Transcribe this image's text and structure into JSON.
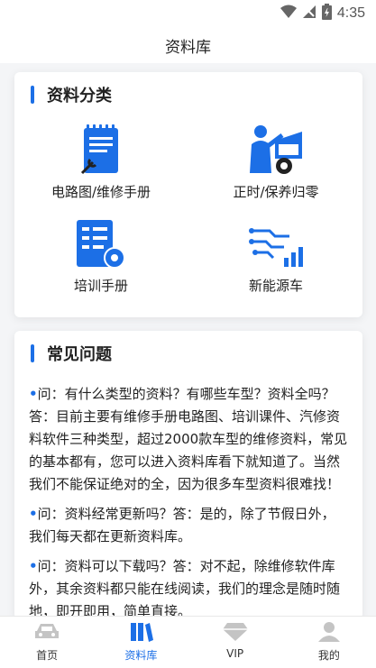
{
  "status": {
    "time": "4:35"
  },
  "header": {
    "title": "资料库"
  },
  "categories": {
    "title": "资料分类",
    "items": [
      {
        "label": "电路图/维修手册",
        "icon": "manual-wrench-icon"
      },
      {
        "label": "正时/保养归零",
        "icon": "mechanic-car-icon"
      },
      {
        "label": "培训手册",
        "icon": "document-gear-icon"
      },
      {
        "label": "新能源车",
        "icon": "circuit-chart-icon"
      }
    ]
  },
  "faq": {
    "title": "常见问题",
    "items": [
      {
        "text": "问：有什么类型的资料？有哪些车型？资料全吗？答：目前主要有维修手册电路图、培训课件、汽修资料软件三种类型，超过2000款车型的维修资料，常见的基本都有，您可以进入资料库看下就知道了。当然我们不能保证绝对的全，因为很多车型资料很难找！"
      },
      {
        "text": "问：资料经常更新吗？答：是的，除了节假日外，我们每天都在更新资料库。"
      },
      {
        "text": "问：资料可以下载吗？答：对不起，除维修软件库外，其余资料都只能在线阅读，我们的理念是随时随地，即开即用，简单直接。"
      }
    ]
  },
  "tabbar": {
    "items": [
      {
        "label": "首页",
        "icon": "car-icon"
      },
      {
        "label": "资料库",
        "icon": "books-icon"
      },
      {
        "label": "VIP",
        "icon": "diamond-icon"
      },
      {
        "label": "我的",
        "icon": "user-icon"
      }
    ]
  },
  "colors": {
    "accent": "#1c6fe6",
    "inactive_tab": "#c4c4c4"
  }
}
